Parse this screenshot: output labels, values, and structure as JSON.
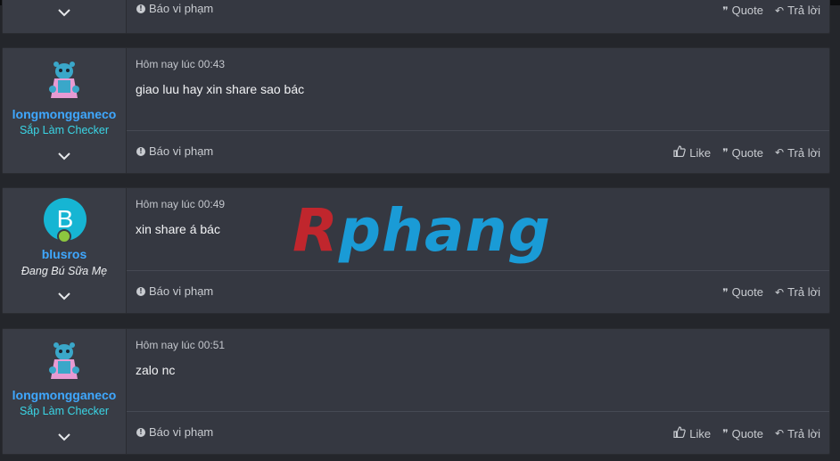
{
  "colors": {
    "page_bg": "#24262b",
    "post_bg": "#353841",
    "username": "#3fa8ff",
    "usertitle_rank": "#3ad6e6",
    "avatar_letter_bg": "#16b5d3",
    "online": "#8dc63f"
  },
  "posts": [
    {
      "partial": true,
      "report_label": "Báo vi phạm",
      "quote_label": "Quote",
      "reply_label": "Trả lời"
    },
    {
      "username": "longmongganeco",
      "user_title": "Sắp Làm Checker",
      "time": "Hôm nay lúc 00:43",
      "body": "giao luu hay xin share sao bác",
      "report_label": "Báo vi phạm",
      "like_label": "Like",
      "quote_label": "Quote",
      "reply_label": "Trả lời"
    },
    {
      "username": "blusros",
      "avatar_letter": "B",
      "user_title": "Đang Bú Sữa Mẹ",
      "time": "Hôm nay lúc 00:49",
      "body": "xin share á bác",
      "report_label": "Báo vi phạm",
      "quote_label": "Quote",
      "reply_label": "Trả lời"
    },
    {
      "username": "longmongganeco",
      "user_title": "Sắp Làm Checker",
      "time": "Hôm nay lúc 00:51",
      "body": "zalo nc",
      "report_label": "Báo vi phạm",
      "like_label": "Like",
      "quote_label": "Quote",
      "reply_label": "Trả lời"
    }
  ],
  "watermark": {
    "first": "R",
    "rest": "phang"
  }
}
